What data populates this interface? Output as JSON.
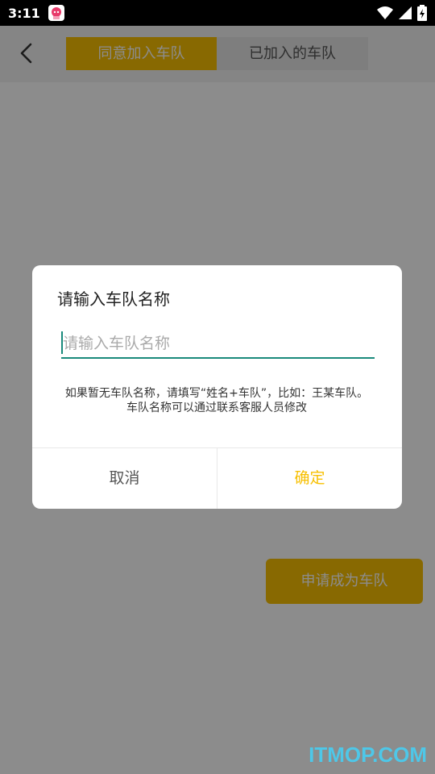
{
  "status_bar": {
    "time": "3:11"
  },
  "header": {
    "tabs": [
      {
        "label": "同意加入车队",
        "active": true
      },
      {
        "label": "已加入的车队",
        "active": false
      }
    ]
  },
  "main": {
    "apply_button": "申请成为车队"
  },
  "dialog": {
    "title": "请输入车队名称",
    "input_placeholder": "请输入车队名称",
    "input_value": "",
    "hint": "如果暂无车队名称，请填写“姓名+车队”，比如：王某车队。车队名称可以通过联系客服人员修改",
    "cancel_label": "取消",
    "confirm_label": "确定"
  },
  "watermark": "ITMOP.COM",
  "colors": {
    "accent": "#f7c003",
    "input_underline": "#1a8a7c",
    "overlay": "rgba(0,0,0,0.45)"
  }
}
